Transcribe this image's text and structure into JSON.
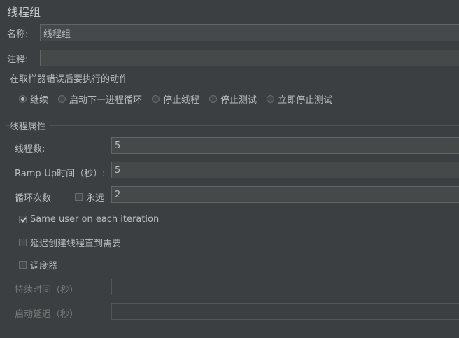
{
  "panel": {
    "title": "线程组"
  },
  "name_field": {
    "label": "名称:",
    "value": "线程组"
  },
  "comment_field": {
    "label": "注释:",
    "value": ""
  },
  "sampler_error_group": {
    "title": "在取样器错误后要执行的动作",
    "options": [
      {
        "label": "继续",
        "selected": true
      },
      {
        "label": "启动下一进程循环",
        "selected": false
      },
      {
        "label": "停止线程",
        "selected": false
      },
      {
        "label": "停止测试",
        "selected": false
      },
      {
        "label": "立即停止测试",
        "selected": false
      }
    ]
  },
  "thread_props": {
    "title": "线程属性",
    "threads_label": "线程数:",
    "threads_value": "5",
    "rampup_label": "Ramp-Up时间（秒）:",
    "rampup_value": "5",
    "loop_label": "循环次数",
    "forever_label": "永远",
    "forever_checked": false,
    "loop_value": "2",
    "same_user_label": "Same user on each iteration",
    "same_user_checked": true,
    "delay_create_label": "延迟创建线程直到需要",
    "delay_create_checked": false,
    "scheduler_label": "调度器",
    "scheduler_checked": false,
    "duration_label": "持续时间（秒）",
    "duration_value": "",
    "startup_delay_label": "启动延迟（秒）",
    "startup_delay_value": ""
  }
}
